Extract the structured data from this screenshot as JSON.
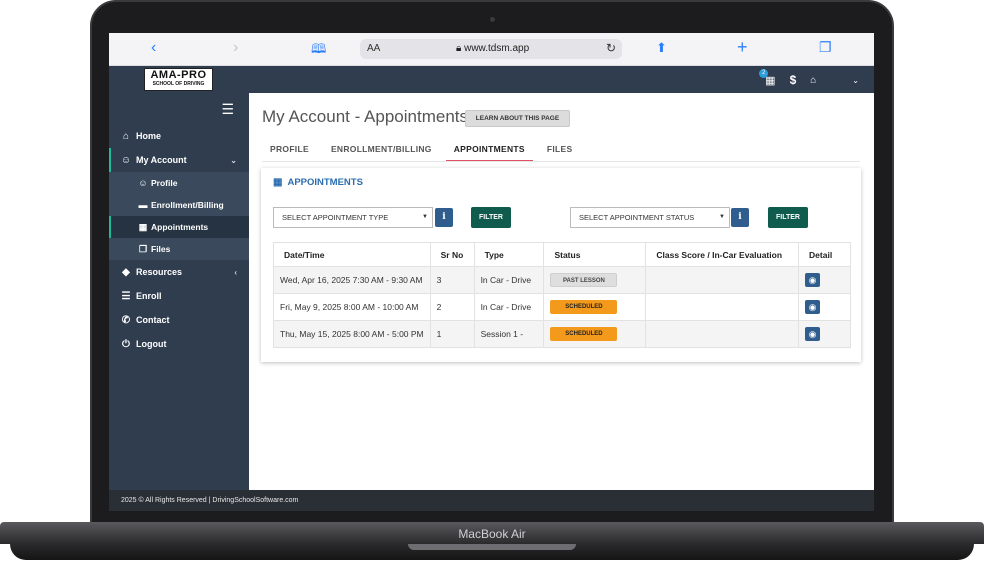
{
  "device": {
    "label": "MacBook Air"
  },
  "browser": {
    "url_aa": "AA",
    "url": "www.tdsm.app"
  },
  "logo": {
    "main": "AMA-PRO",
    "sub": "SCHOOL OF DRIVING"
  },
  "header": {
    "badge_count": "2",
    "dollar": "$"
  },
  "sidebar": {
    "items": [
      {
        "label": "Home"
      },
      {
        "label": "My Account"
      },
      {
        "label": "Profile"
      },
      {
        "label": "Enrollment/Billing"
      },
      {
        "label": "Appointments"
      },
      {
        "label": "Files"
      },
      {
        "label": "Resources"
      },
      {
        "label": "Enroll"
      },
      {
        "label": "Contact"
      },
      {
        "label": "Logout"
      }
    ]
  },
  "page": {
    "title": "My Account - Appointments",
    "learn_button": "LEARN ABOUT THIS PAGE",
    "tabs": [
      {
        "label": "PROFILE"
      },
      {
        "label": "ENROLLMENT/BILLING"
      },
      {
        "label": "APPOINTMENTS"
      },
      {
        "label": "FILES"
      }
    ]
  },
  "panel": {
    "title": "APPOINTMENTS",
    "select_type": "SELECT APPOINTMENT TYPE",
    "select_status": "SELECT APPOINTMENT STATUS",
    "filter_label": "FILTER",
    "info_glyph": "i"
  },
  "table": {
    "headers": [
      "Date/Time",
      "Sr No",
      "Type",
      "Status",
      "Class Score / In-Car Evaluation",
      "Detail"
    ],
    "rows": [
      {
        "datetime": "Wed, Apr 16, 2025 7:30 AM - 9:30 AM",
        "sr": "3",
        "type": "In Car - Drive",
        "status": "PAST LESSON",
        "score": ""
      },
      {
        "datetime": "Fri, May 9, 2025 8:00 AM - 10:00 AM",
        "sr": "2",
        "type": "In Car - Drive",
        "status": "SCHEDULED",
        "score": ""
      },
      {
        "datetime": "Thu, May 15, 2025 8:00 AM - 5:00 PM",
        "sr": "1",
        "type": "Session 1 -",
        "status": "SCHEDULED",
        "score": ""
      }
    ]
  },
  "footer": {
    "text": "2025 © All Rights Reserved | DrivingSchoolSoftware.com"
  },
  "colors": {
    "sidebar_bg": "#2f3d4e",
    "accent_teal": "#1abc9c",
    "filter_green": "#0f5c4e",
    "info_blue": "#2f5d8e",
    "scheduled_orange": "#f39a1c",
    "tab_underline": "#e05260"
  }
}
